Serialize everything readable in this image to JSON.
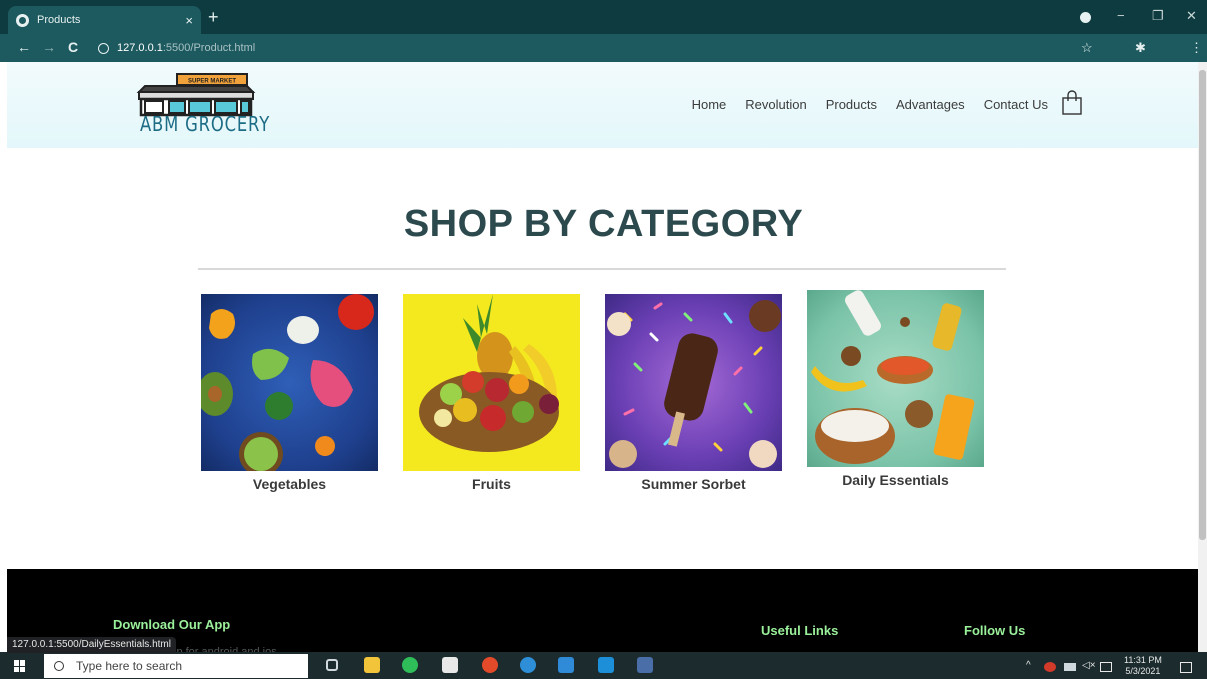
{
  "browser": {
    "tab_title": "Products",
    "tab_close": "×",
    "new_tab": "+",
    "url_host": "127.0.0.1",
    "url_path": ":5500/Product.html",
    "status_url": "127.0.0.1:5500/DailyEssentials.html",
    "back": "←",
    "forward": "→",
    "reload": "C",
    "minimize": "−",
    "restore": "❐",
    "close": "✕",
    "star": "☆",
    "puzzle": "✱",
    "menu": "⋮"
  },
  "site": {
    "logo_text": "ABM GROCERY",
    "logo_sign": "SUPER MARKET",
    "nav": [
      "Home",
      "Revolution",
      "Products",
      "Advantages",
      "Contact Us"
    ]
  },
  "main": {
    "heading": "SHOP BY CATEGORY",
    "categories": [
      {
        "label": "Vegetables"
      },
      {
        "label": "Fruits"
      },
      {
        "label": "Summer Sorbet"
      },
      {
        "label": "Daily Essentials"
      }
    ]
  },
  "footer": {
    "download_title": "Download Our App",
    "download_sub": "App for android and ios",
    "useful_links": "Useful Links",
    "follow_us": "Follow Us"
  },
  "taskbar": {
    "search_placeholder": "Type here to search",
    "time": "11:31 PM",
    "date": "5/3/2021"
  },
  "colors": {
    "chrome_dark": "#0d3b40",
    "chrome_mid": "#1d5a5f",
    "heading": "#2c4a4d",
    "footer_title": "#9bf09b"
  }
}
